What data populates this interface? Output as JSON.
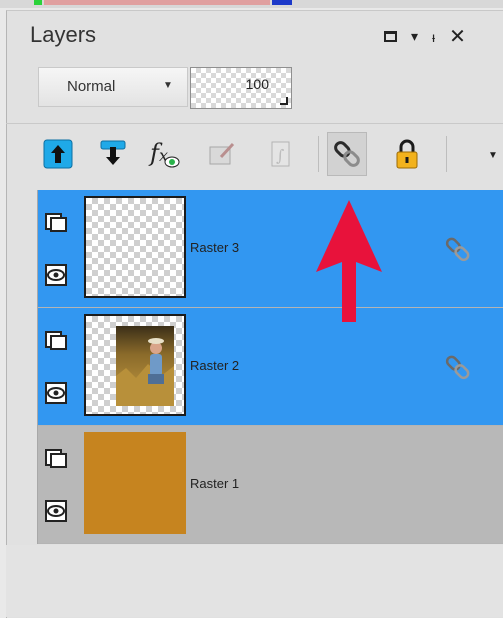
{
  "panel": {
    "title": "Layers"
  },
  "window_controls": {
    "restore": "restore-icon",
    "dropdown": "▾",
    "pin": "ᵻ",
    "close": "✕"
  },
  "properties": {
    "blend_mode": "Normal",
    "opacity": "100"
  },
  "toolbar": {
    "buttons": [
      "move-up-icon",
      "move-down-icon",
      "fx-eye-icon",
      "edit-mask-icon",
      "script-icon",
      "link-icon",
      "lock-icon"
    ],
    "active": "link-icon"
  },
  "layers": [
    {
      "name": "Raster 3",
      "selected": true,
      "linked": true,
      "thumb": "transparent"
    },
    {
      "name": "Raster 2",
      "selected": true,
      "linked": true,
      "thumb": "photo"
    },
    {
      "name": "Raster 1",
      "selected": false,
      "linked": false,
      "thumb": "fill",
      "fill_color": "#c6841f"
    }
  ],
  "colors": {
    "selection": "#3297f1",
    "annotation_arrow": "#e8123b",
    "raster1_fill": "#c6841f"
  }
}
